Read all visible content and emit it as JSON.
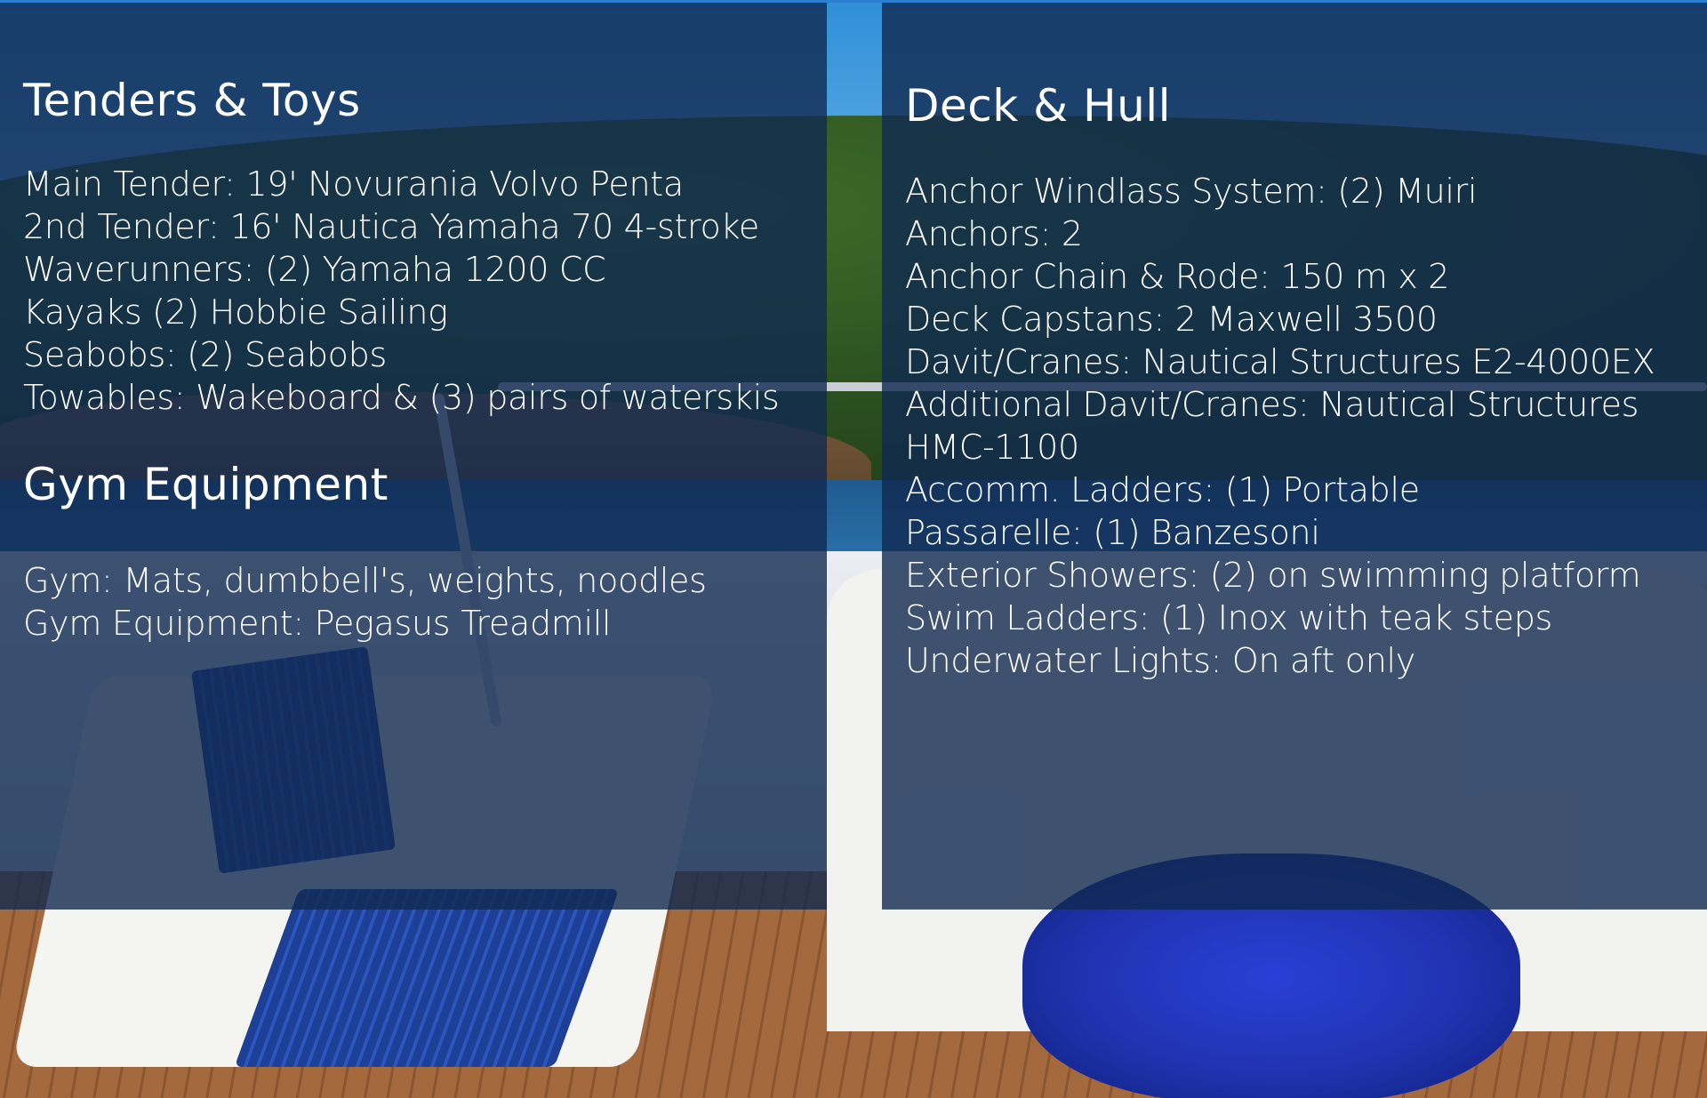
{
  "tenders_toys": {
    "title": "Tenders & Toys",
    "items": [
      "Main Tender: 19' Novurania Volvo Penta",
      "2nd Tender: 16' Nautica Yamaha 70 4-stroke",
      "Waverunners: (2) Yamaha 1200 CC",
      "Kayaks (2) Hobbie Sailing",
      "Seabobs: (2) Seabobs",
      "Towables: Wakeboard & (3) pairs of waterskis"
    ]
  },
  "gym_equipment": {
    "title": "Gym Equipment",
    "items": [
      "Gym: Mats, dumbbell's, weights, noodles",
      "Gym Equipment: Pegasus Treadmill"
    ]
  },
  "deck_hull": {
    "title": "Deck & Hull",
    "items": [
      "Anchor Windlass System: (2) Muiri",
      "Anchors: 2",
      "Anchor Chain & Rode: 150 m x 2",
      "Deck Capstans: 2 Maxwell 3500",
      "Davit/Cranes: Nautical Structures E2-4000EX",
      "Additional Davit/Cranes: Nautical Structures HMC-1100",
      "Accomm. Ladders: (1) Portable",
      "Passarelle: (1) Banzesoni",
      "Exterior Showers: (2) on swimming platform",
      "Swim Ladders: (1) Inox with teak steps",
      "Underwater Lights: On aft only"
    ]
  },
  "colors": {
    "panel_overlay": "#102950",
    "text": "#ffffff",
    "accent_line": "#2a7fd0"
  }
}
